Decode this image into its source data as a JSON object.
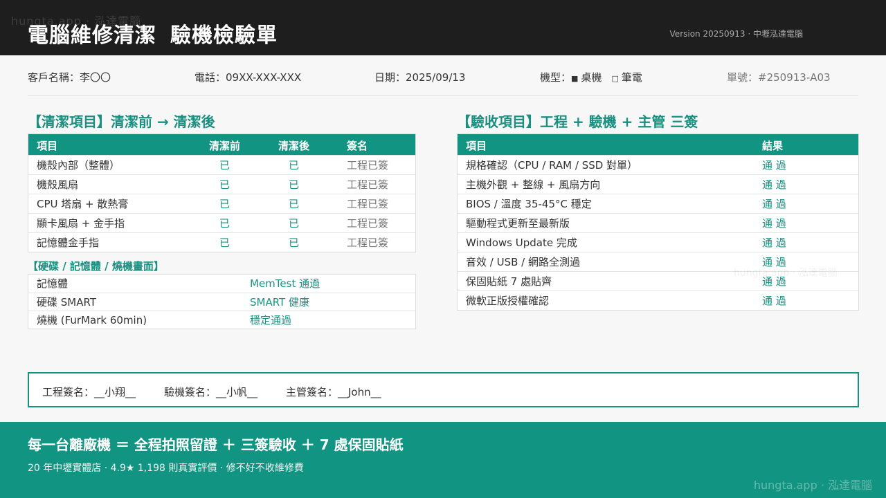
{
  "header": {
    "watermark": "hungta.app · 泓達電腦",
    "title_part1": "電腦維修清潔",
    "title_part2": "驗機檢驗單",
    "version": "Version 20250913 · 中壢泓達電腦"
  },
  "info": {
    "customer": "客戶名稱：李〇〇",
    "phone": "電話：09XX-XXX-XXX",
    "date": "日期：2025/09/13",
    "model_label": "機型：",
    "model_desktop_mark": "■",
    "model_desktop": "桌機",
    "model_laptop_mark": "□",
    "model_laptop": "筆電",
    "order_no": "單號：#250913-A03"
  },
  "cleaning": {
    "title": "【清潔項目】清潔前 → 清潔後",
    "headers": [
      "項目",
      "清潔前",
      "清潔後",
      "簽名"
    ],
    "rows": [
      [
        "機殼內部（整體）",
        "已",
        "已",
        "工程已簽"
      ],
      [
        "機殼風扇",
        "已",
        "已",
        "工程已簽"
      ],
      [
        "CPU 塔扇 + 散熱膏",
        "已",
        "已",
        "工程已簽"
      ],
      [
        "顯卡風扇 + 金手指",
        "已",
        "已",
        "工程已簽"
      ],
      [
        "記憶體金手指",
        "已",
        "已",
        "工程已簽"
      ]
    ]
  },
  "hardware": {
    "title": "【硬碟 / 記憶體 / 燒機畫面】",
    "rows": [
      [
        "記憶體",
        "MemTest 通過"
      ],
      [
        "硬碟 SMART",
        "SMART 健康"
      ],
      [
        "燒機 (FurMark 60min)",
        "穩定通過"
      ]
    ]
  },
  "acceptance": {
    "title": "【驗收項目】工程 + 驗機 + 主管 三簽",
    "headers": [
      "項目",
      "結果"
    ],
    "rows": [
      [
        "規格確認（CPU / RAM / SSD 對單）",
        "通 過"
      ],
      [
        "主機外觀 + 整線 + 風扇方向",
        "通 過"
      ],
      [
        "BIOS / 溫度 35-45°C 穩定",
        "通 過"
      ],
      [
        "驅動程式更新至最新版",
        "通 過"
      ],
      [
        "Windows Update 完成",
        "通 過"
      ],
      [
        "音效 / USB / 網路全測過",
        "通 過"
      ],
      [
        "保固貼紙 7 處貼齊",
        "通 過"
      ],
      [
        "微軟正版授權確認",
        "通 過"
      ]
    ]
  },
  "signatures": {
    "engineer": "工程簽名：__小翔__",
    "inspector": "驗機簽名：__小帆__",
    "manager": "主管簽名：__John__"
  },
  "footer": {
    "slogan": "每一台離廠機 ＝ 全程拍照留證 ＋ 三簽驗收 ＋ 7 處保固貼紙",
    "tagline": "20 年中壢實體店 · 4.9★ 1,198 則真實評價 · 修不好不收維修費",
    "watermark": "hungta.app · 泓達電腦"
  },
  "colors": {
    "accent": "#119481",
    "header_bg": "#1e1e1e",
    "text_green": "#1a8f80"
  }
}
